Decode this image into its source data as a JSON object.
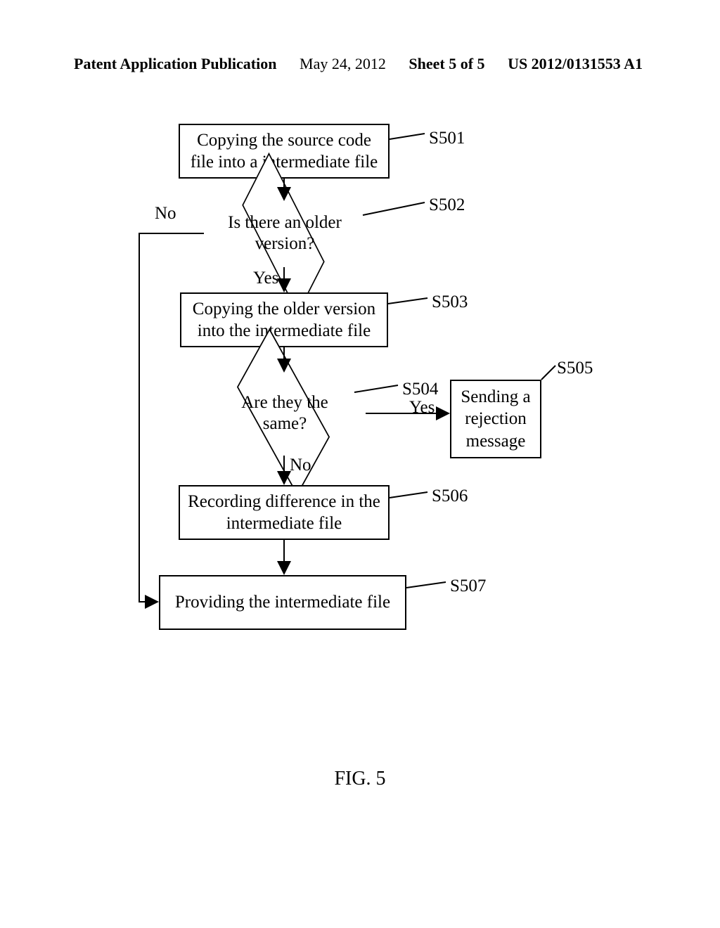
{
  "header": {
    "left": "Patent Application Publication",
    "date": "May 24, 2012",
    "sheet": "Sheet 5 of 5",
    "docnum": "US 2012/0131553 A1"
  },
  "steps": {
    "s501": {
      "id": "S501",
      "text": "Copying the source code file into a intermediate file"
    },
    "s502": {
      "id": "S502",
      "text": "Is there an older version?"
    },
    "s503": {
      "id": "S503",
      "text": "Copying the older version into the intermediate file"
    },
    "s504": {
      "id": "S504",
      "text": "Are they the same?"
    },
    "s505": {
      "id": "S505",
      "text": "Sending a rejection message"
    },
    "s506": {
      "id": "S506",
      "text": "Recording difference in the intermediate file"
    },
    "s507": {
      "id": "S507",
      "text": "Providing the intermediate file"
    }
  },
  "labels": {
    "yes": "Yes",
    "no": "No"
  },
  "figure_label": "FIG. 5"
}
